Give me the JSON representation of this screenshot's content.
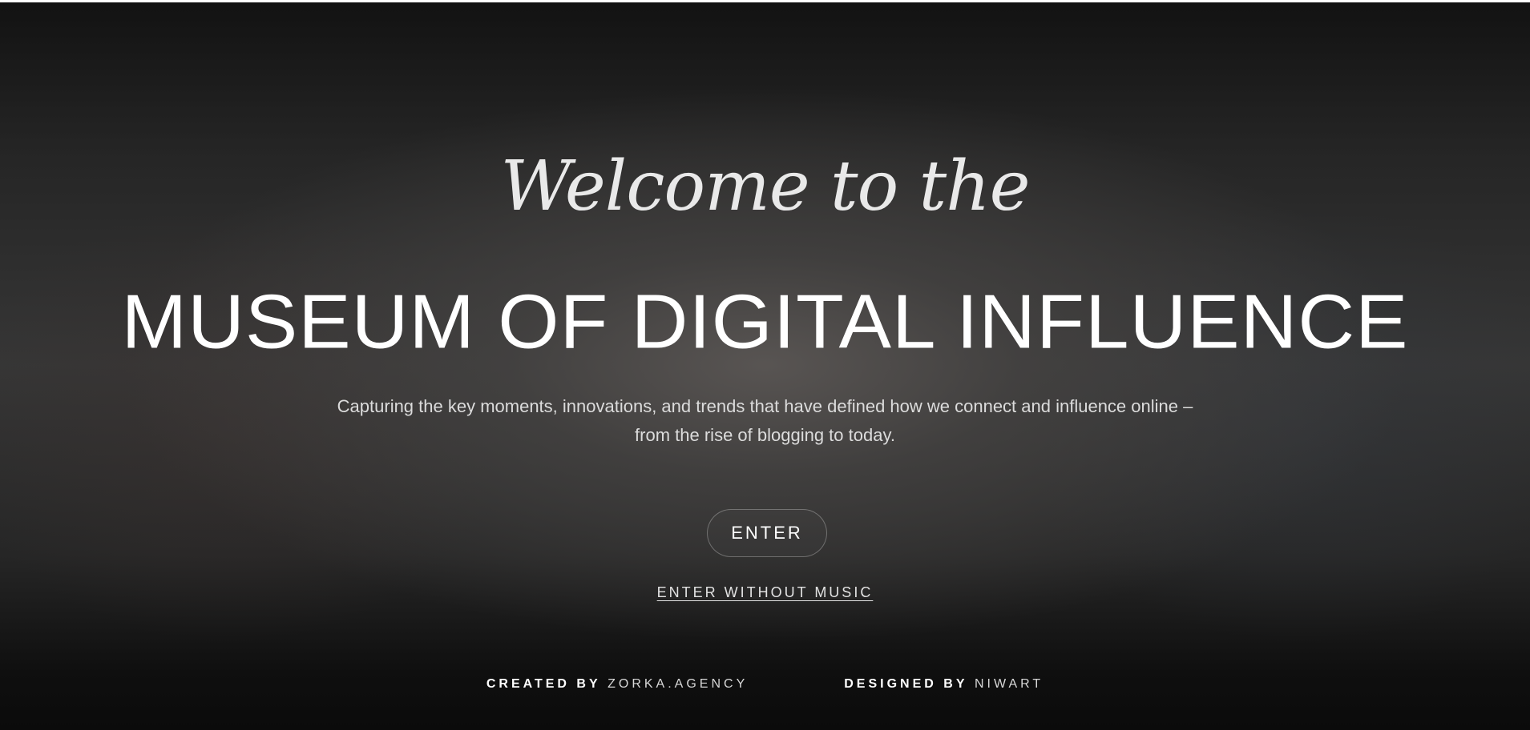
{
  "hero": {
    "welcome": "Welcome to the",
    "title": "MUSEUM OF DIGITAL INFLUENCE",
    "subtitle_line1": "Capturing the key moments, innovations, and trends that have defined how we connect and influence online –",
    "subtitle_line2": "from the rise of blogging to today."
  },
  "actions": {
    "enter_label": "ENTER",
    "enter_without_music_label": "ENTER WITHOUT MUSIC"
  },
  "footer": {
    "created_by_label": "CREATED BY",
    "created_by_value": "ZORKA.AGENCY",
    "designed_by_label": "DESIGNED BY",
    "designed_by_value": "NIWART"
  },
  "colors": {
    "background": "#262626",
    "text": "#ffffff"
  }
}
